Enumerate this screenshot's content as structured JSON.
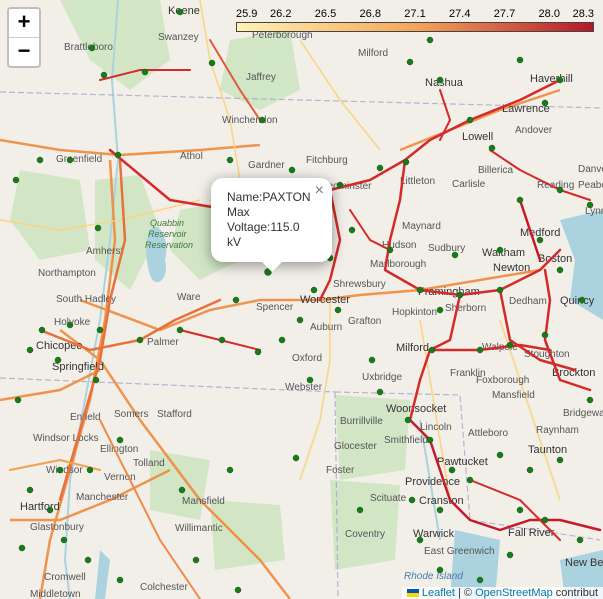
{
  "map": {
    "zoom_in_label": "+",
    "zoom_out_label": "−",
    "colorbar": {
      "ticks": [
        "25.9",
        "26.2",
        "26.5",
        "26.8",
        "27.1",
        "27.4",
        "27.7",
        "28.0",
        "28.3"
      ],
      "color_low": "#fff2b2",
      "color_mid": "#f5a65a",
      "color_high": "#b2182b"
    },
    "popup": {
      "name": "Name:PAXTON",
      "line2": "Max",
      "line3": "Voltage:115.0",
      "line4": "kV",
      "close": "×"
    },
    "attribution": {
      "leaflet": "Leaflet",
      "separator": " | © ",
      "osm": "OpenStreetMap",
      "suffix": " contribut"
    },
    "place_labels": [
      "Keene",
      "Swanzey",
      "Brattleboro",
      "Peterborough",
      "Milford",
      "Nashua",
      "Haverhill",
      "Jaffrey",
      "Lawrence",
      "Andover",
      "Winchendon",
      "Lowell",
      "Greenfield",
      "Athol",
      "Gardner",
      "Fitchburg",
      "Leominster",
      "Littleton",
      "Carlisle",
      "Billerica",
      "Reading",
      "Peabody",
      "Danvers",
      "Lynn",
      "Maynard",
      "Medford",
      "Hudson",
      "Sudbury",
      "Waltham",
      "Boston",
      "Amherst",
      "Marlborough",
      "Newton",
      "Northampton",
      "Shrewsbury",
      "Framingham",
      "Ware",
      "Spencer",
      "Worcester",
      "South Hadley",
      "Holyoke",
      "Sherborn",
      "Dedham",
      "Quincy",
      "Chicopee",
      "Palmer",
      "Auburn",
      "Grafton",
      "Hopkinton",
      "Springfield",
      "Oxford",
      "Milford",
      "Walpole",
      "Stoughton",
      "Brockton",
      "Franklin",
      "Uxbridge",
      "Foxborough",
      "Mansfield",
      "Webster",
      "Enfield",
      "Somers",
      "Stafford",
      "Bridgewater",
      "Woonsocket",
      "Burrillville",
      "Lincoln",
      "Attleboro",
      "Raynham",
      "Windsor Locks",
      "Ellington",
      "Glocester",
      "Smithfield",
      "Pawtucket",
      "Taunton",
      "Tolland",
      "Foster",
      "Providence",
      "Windsor",
      "Vernon",
      "Manchester",
      "Mansfield",
      "Scituate",
      "Cranston",
      "Fall River",
      "Hartford",
      "Glastonbury",
      "Willimantic",
      "Coventry",
      "Warwick",
      "East Greenwich",
      "New Bedford",
      "Cromwell",
      "Colchester",
      "Middletown",
      "Rhode Island"
    ],
    "park_labels": [
      "Quabbin",
      "Reservoir",
      "Reservation"
    ]
  }
}
